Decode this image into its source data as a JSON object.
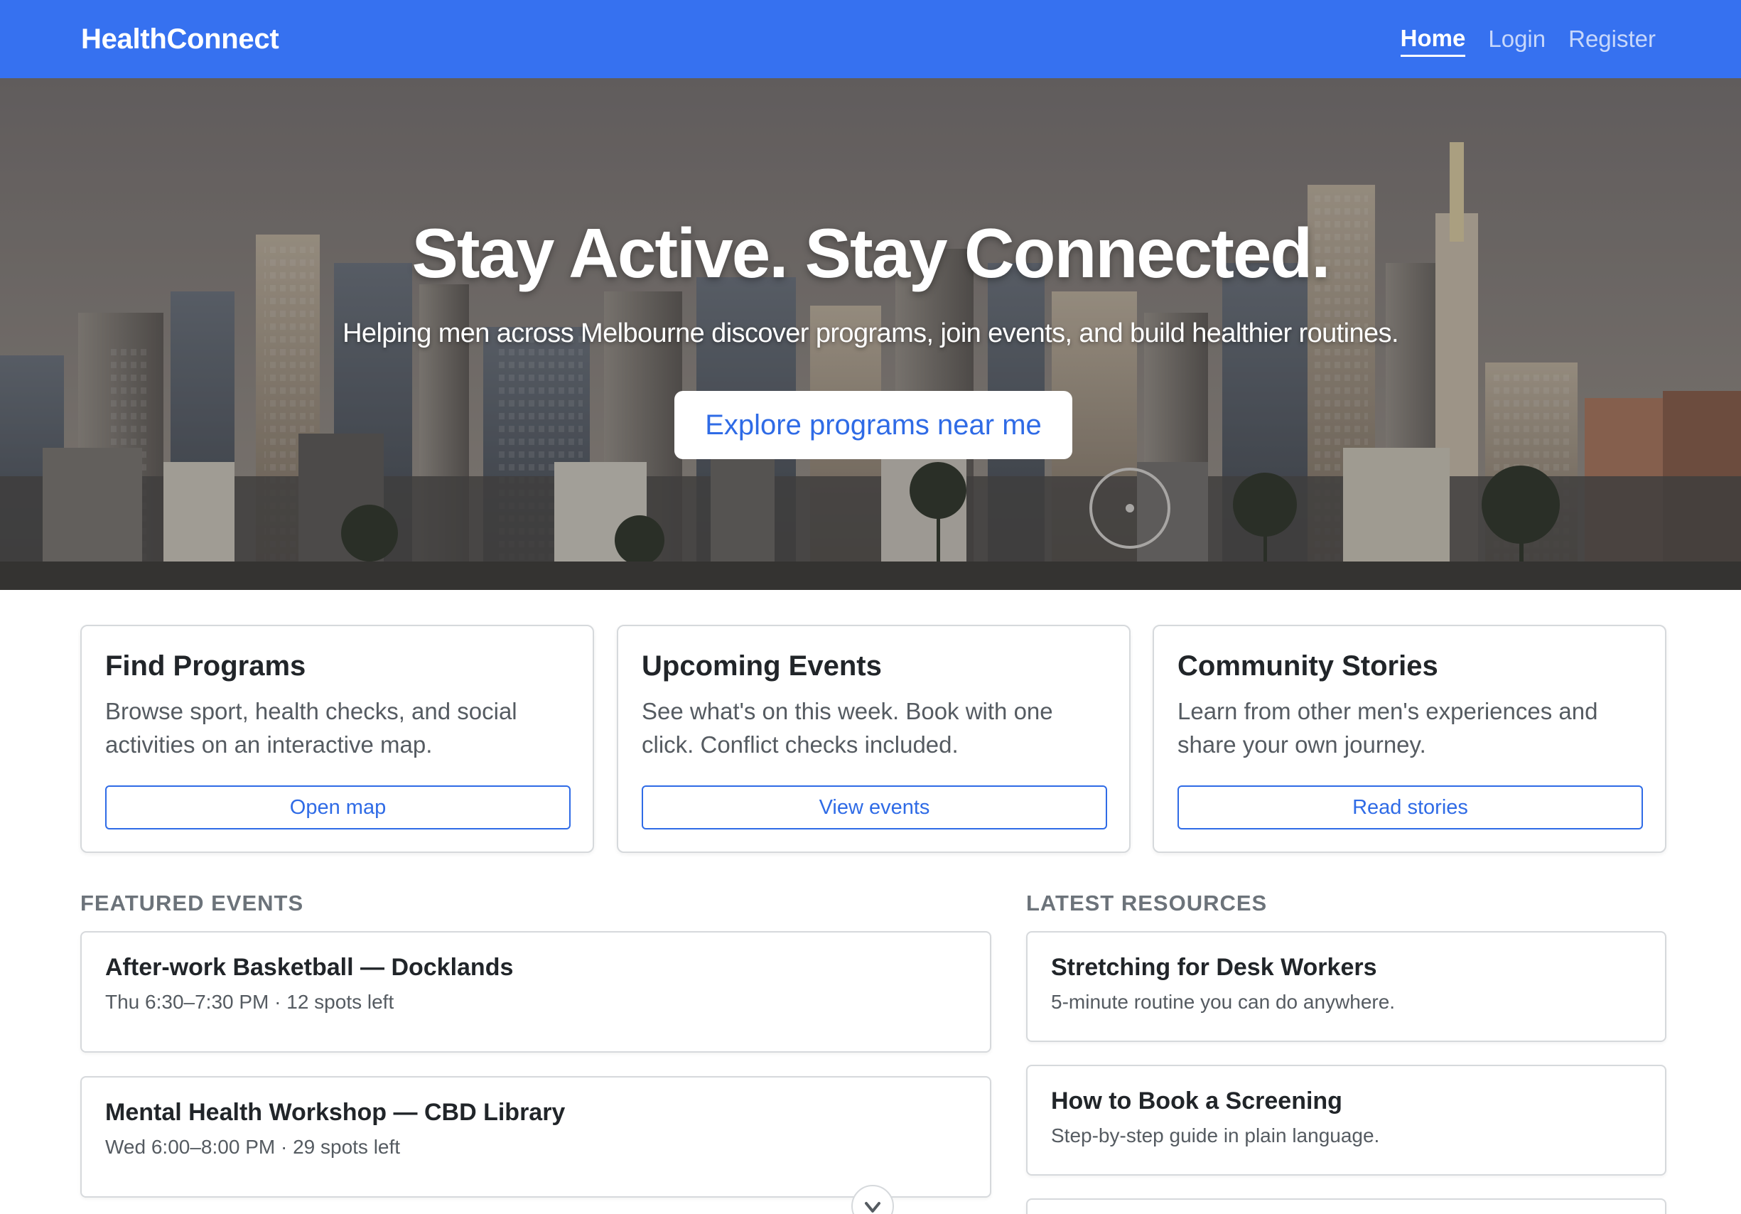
{
  "nav": {
    "brand": "HealthConnect",
    "links": [
      {
        "label": "Home",
        "active": true
      },
      {
        "label": "Login",
        "active": false
      },
      {
        "label": "Register",
        "active": false
      }
    ],
    "color": "#3671f0"
  },
  "hero": {
    "title": "Stay Active. Stay Connected.",
    "subtitle": "Helping men across Melbourne discover programs, join events, and build healthier routines.",
    "cta": "Explore programs near me",
    "background": "melbourne-skyline-photo"
  },
  "cards": [
    {
      "title": "Find Programs",
      "body": "Browse sport, health checks, and social activities on an interactive map.",
      "button": "Open map"
    },
    {
      "title": "Upcoming Events",
      "body": "See what's on this week. Book with one click. Conflict checks included.",
      "button": "View events"
    },
    {
      "title": "Community Stories",
      "body": "Learn from other men's experiences and share your own journey.",
      "button": "Read stories"
    }
  ],
  "featured_events": {
    "heading": "FEATURED EVENTS",
    "items": [
      {
        "title": "After-work Basketball — Docklands",
        "meta": "Thu 6:30–7:30 PM · 12 spots left"
      },
      {
        "title": "Mental Health Workshop — CBD Library",
        "meta": "Wed 6:00–8:00 PM · 29 spots left"
      }
    ]
  },
  "latest_resources": {
    "heading": "LATEST RESOURCES",
    "items": [
      {
        "title": "Stretching for Desk Workers",
        "meta": "5-minute routine you can do anywhere."
      },
      {
        "title": "How to Book a Screening",
        "meta": "Step-by-step guide in plain language."
      }
    ]
  },
  "scroll_icon": "chevron-down-icon"
}
